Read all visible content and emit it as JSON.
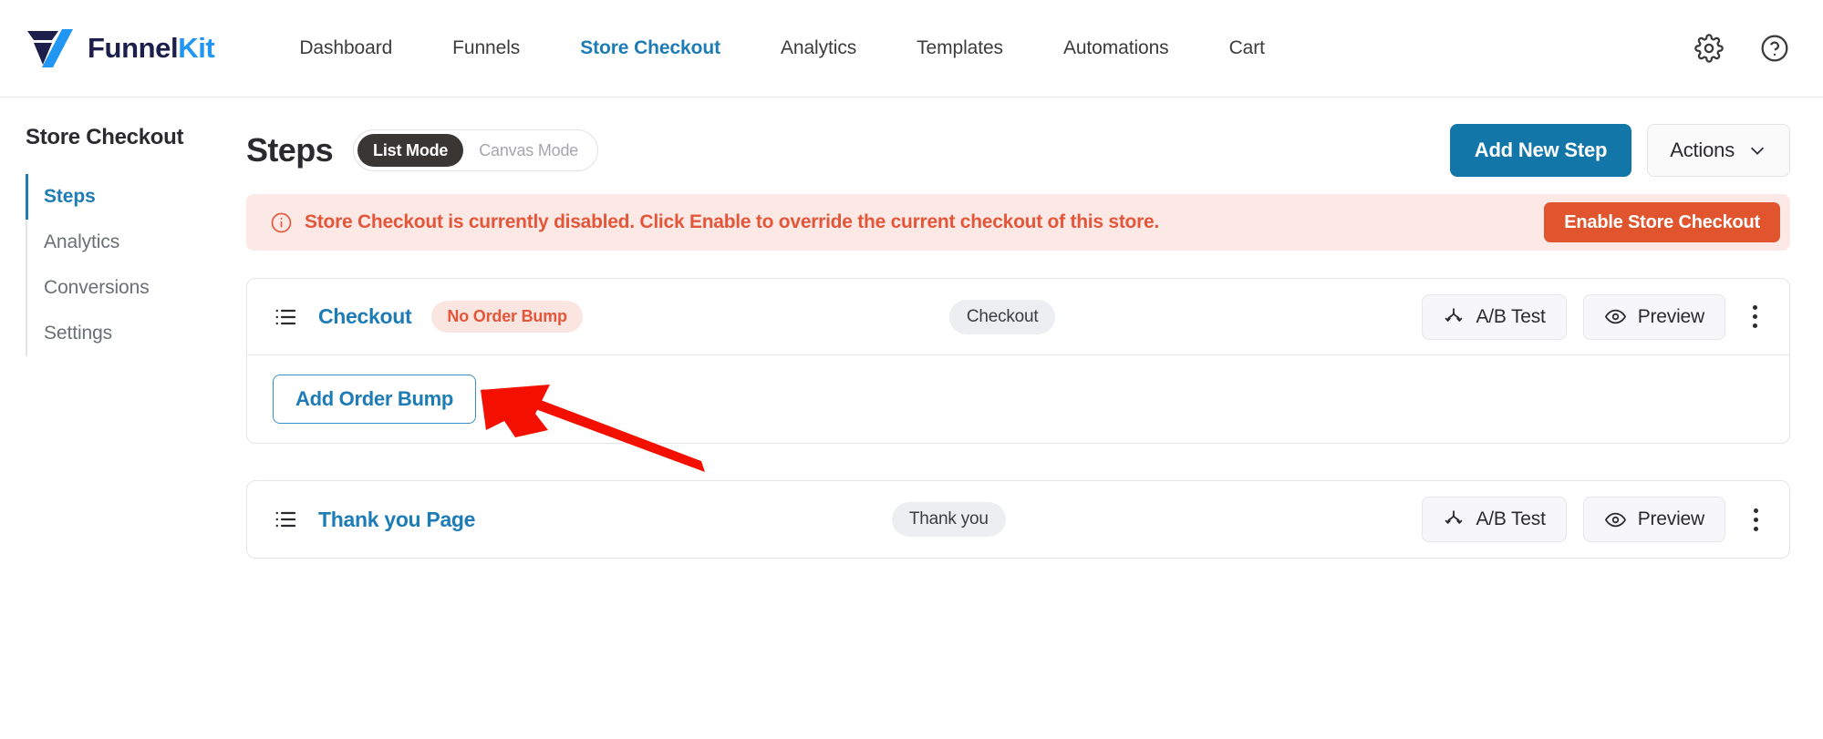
{
  "brand": {
    "name_part1": "Funnel",
    "name_part2": "Kit",
    "logo_icon": "funnelkit-logo-icon"
  },
  "topnav": {
    "items": [
      {
        "label": "Dashboard",
        "active": false
      },
      {
        "label": "Funnels",
        "active": false
      },
      {
        "label": "Store Checkout",
        "active": true
      },
      {
        "label": "Analytics",
        "active": false
      },
      {
        "label": "Templates",
        "active": false
      },
      {
        "label": "Automations",
        "active": false
      },
      {
        "label": "Cart",
        "active": false
      }
    ],
    "settings_icon": "gear-icon",
    "help_icon": "question-circle-icon"
  },
  "sidebar": {
    "title": "Store Checkout",
    "items": [
      {
        "label": "Steps",
        "active": true
      },
      {
        "label": "Analytics",
        "active": false
      },
      {
        "label": "Conversions",
        "active": false
      },
      {
        "label": "Settings",
        "active": false
      }
    ]
  },
  "main": {
    "title": "Steps",
    "mode_toggle": {
      "list_label": "List Mode",
      "canvas_label": "Canvas Mode",
      "selected": "List Mode"
    },
    "add_new_step_label": "Add New Step",
    "actions_label": "Actions",
    "actions_chevron_icon": "chevron-down-icon",
    "alert": {
      "icon": "info-circle-icon",
      "message": "Store Checkout is currently disabled. Click Enable to override the current checkout of this store.",
      "button_label": "Enable Store Checkout"
    },
    "steps": [
      {
        "icon": "list-icon",
        "name": "Checkout",
        "warning_badge": "No Order Bump",
        "type_badge": "Checkout",
        "ab_test_label": "A/B Test",
        "ab_test_icon": "ab-split-icon",
        "preview_label": "Preview",
        "preview_icon": "eye-icon",
        "menu_icon": "kebab-menu-icon",
        "add_order_bump_label": "Add Order Bump"
      },
      {
        "icon": "list-icon",
        "name": "Thank you Page",
        "warning_badge": "",
        "type_badge": "Thank you",
        "ab_test_label": "A/B Test",
        "ab_test_icon": "ab-split-icon",
        "preview_label": "Preview",
        "preview_icon": "eye-icon",
        "menu_icon": "kebab-menu-icon"
      }
    ]
  },
  "annotation": {
    "arrow_color": "#f41000",
    "arrow_icon": "pointer-arrow-annotation"
  },
  "colors": {
    "accent_blue": "#1d7cb5",
    "primary_button": "#1277a8",
    "danger": "#e0542e",
    "alert_bg": "#fce9e6",
    "alert_text": "#e4563a",
    "badge_bg": "#eceef2",
    "dark_pill": "#3a3633"
  }
}
